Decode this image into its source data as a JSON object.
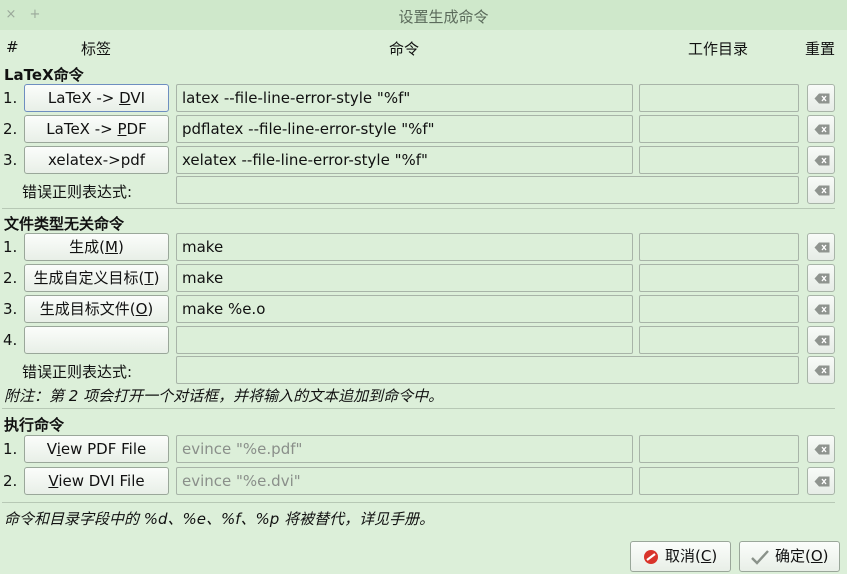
{
  "window": {
    "title": "设置生成命令",
    "close_glyph": "×",
    "pin_glyph": "+"
  },
  "header": {
    "num": "#",
    "label": "标签",
    "command": "命令",
    "workdir": "工作目录",
    "reset": "重置"
  },
  "latex": {
    "title": "LaTeX命令",
    "rows": [
      {
        "num": "1.",
        "label_pre": "LaTeX -> ",
        "label_key": "D",
        "label_post": "VI",
        "command": "latex --file-line-error-style \"%f\""
      },
      {
        "num": "2.",
        "label_pre": "LaTeX -> ",
        "label_key": "P",
        "label_post": "DF",
        "command": "pdflatex --file-line-error-style \"%f\""
      },
      {
        "num": "3.",
        "label": "xelatex->pdf",
        "command": "xelatex --file-line-error-style \"%f\""
      }
    ],
    "regex_label": "错误正则表达式:"
  },
  "independent": {
    "title": "文件类型无关命令",
    "rows": [
      {
        "num": "1.",
        "label_pre": "生成(",
        "label_key": "M",
        "label_post": ")",
        "command": "make"
      },
      {
        "num": "2.",
        "label_pre": "生成自定义目标(",
        "label_key": "T",
        "label_post": ")",
        "command": "make"
      },
      {
        "num": "3.",
        "label_pre": "生成目标文件(",
        "label_key": "O",
        "label_post": ")",
        "command": "make %e.o"
      },
      {
        "num": "4.",
        "label": "",
        "command": ""
      }
    ],
    "regex_label": "错误正则表达式:",
    "note": "附注：第 2 项会打开一个对话框，并将输入的文本追加到命令中。"
  },
  "execute": {
    "title": "执行命令",
    "rows": [
      {
        "num": "1.",
        "label_pre": "V",
        "label_key": "i",
        "label_post": "ew PDF File",
        "command": "evince \"%e.pdf\""
      },
      {
        "num": "2.",
        "label_pre": "",
        "label_key": "V",
        "label_post": "iew DVI File",
        "command": "evince \"%e.dvi\""
      }
    ]
  },
  "footer_note": "命令和目录字段中的 %d、%e、%f、%p 将被替代，详见手册。",
  "buttons": {
    "cancel_pre": "取消(",
    "cancel_key": "C",
    "cancel_post": ")",
    "ok_pre": "确定(",
    "ok_key": "O",
    "ok_post": ")"
  },
  "colors": {
    "background": "#dcefd9",
    "cancel_icon": "#d9342b"
  }
}
